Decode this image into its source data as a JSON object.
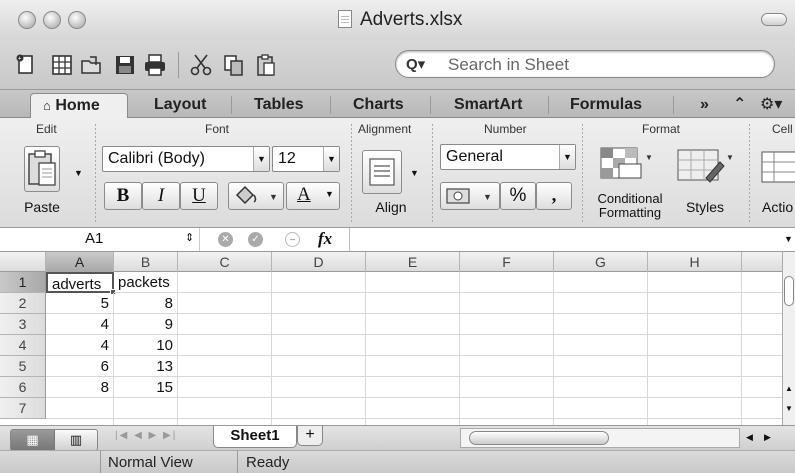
{
  "window": {
    "title": "Adverts.xlsx"
  },
  "toolbar": {
    "icons": [
      "new-icon",
      "templates-icon",
      "open-icon",
      "save-icon",
      "print-icon",
      "cut-icon",
      "copy-icon",
      "paste-icon"
    ],
    "search_placeholder": "Search in Sheet"
  },
  "tabs": {
    "home": "Home",
    "layout": "Layout",
    "tables": "Tables",
    "charts": "Charts",
    "smartart": "SmartArt",
    "formulas": "Formulas",
    "more": "»"
  },
  "ribbon": {
    "edit": {
      "label": "Edit",
      "paste": "Paste"
    },
    "font": {
      "label": "Font",
      "family": "Calibri (Body)",
      "size": "12",
      "bold": "B",
      "italic": "I",
      "underline": "U",
      "font_color": "A"
    },
    "alignment": {
      "label": "Alignment",
      "align": "Align"
    },
    "number": {
      "label": "Number",
      "format": "General",
      "percent": "%",
      "comma": ","
    },
    "format": {
      "label": "Format",
      "conditional_1": "Conditional",
      "conditional_2": "Formatting",
      "styles": "Styles"
    },
    "cells": {
      "label": "Cell",
      "actions": "Actio"
    }
  },
  "formula_bar": {
    "name_box": "A1",
    "fx": "fx",
    "content": ""
  },
  "grid": {
    "columns": [
      "A",
      "B",
      "C",
      "D",
      "E",
      "F",
      "G",
      "H"
    ],
    "rows": [
      "1",
      "2",
      "3",
      "4",
      "5",
      "6",
      "7"
    ],
    "cells": {
      "A1": "adverts",
      "B1": "packets",
      "A2": "5",
      "B2": "8",
      "A3": "4",
      "B3": "9",
      "A4": "4",
      "B4": "10",
      "A5": "6",
      "B5": "13",
      "A6": "8",
      "B6": "15"
    }
  },
  "sheet_tabs": {
    "active": "Sheet1",
    "add": "+"
  },
  "status": {
    "view": "Normal View",
    "state": "Ready"
  }
}
